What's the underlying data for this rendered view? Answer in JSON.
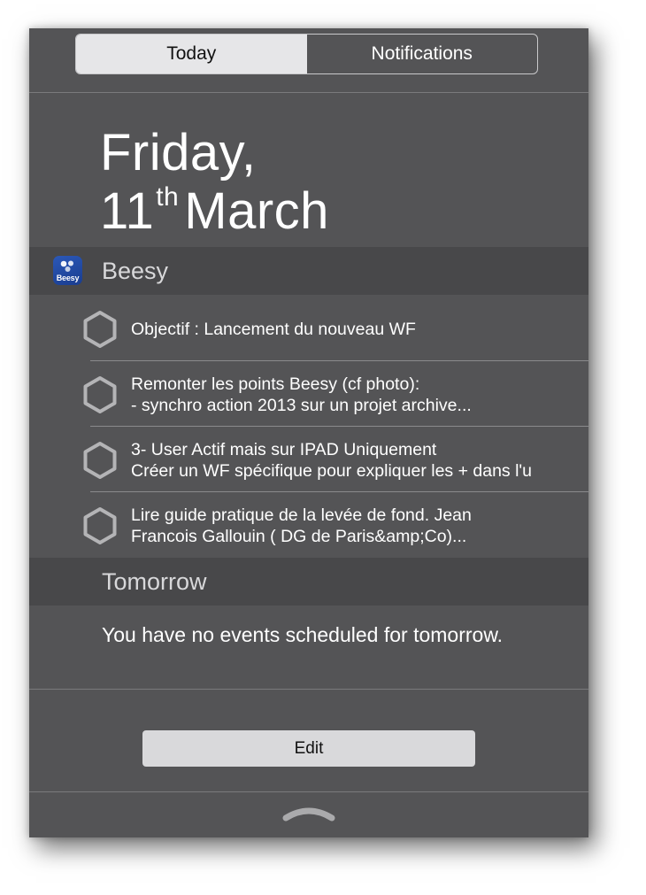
{
  "tabs": {
    "today": "Today",
    "notifications": "Notifications"
  },
  "date": {
    "weekday_line": "Friday,",
    "day_number": "11",
    "day_suffix": "th",
    "month": "March"
  },
  "beesy_section": {
    "title": "Beesy",
    "icon_label": "Beesy",
    "tasks": [
      {
        "line1": "Objectif : Lancement du nouveau WF",
        "line2": ""
      },
      {
        "line1": "Remonter les points Beesy (cf photo):",
        "line2": "- synchro action 2013 sur un projet archive..."
      },
      {
        "line1": "3- User Actif mais sur IPAD Uniquement",
        "line2": "Créer un WF spécifique pour expliquer les + dans l'u"
      },
      {
        "line1": "Lire  guide pratique de la levée de fond. Jean",
        "line2": "Francois Gallouin ( DG de Paris&amp;Co)..."
      }
    ]
  },
  "tomorrow_section": {
    "title": "Tomorrow",
    "message": "You have no events scheduled for tomorrow."
  },
  "edit_label": "Edit",
  "colors": {
    "panel_bg": "#545456",
    "header_bg": "#48484a",
    "segment_active": "#e6e6e8",
    "hex_stroke": "#b4b4b6",
    "app_icon_blue": "#2b58b8"
  },
  "icons": {
    "task_checkbox": "hexagon-outline-icon",
    "app": "beesy-app-icon",
    "grabber": "chevron-up-grabber-icon"
  }
}
